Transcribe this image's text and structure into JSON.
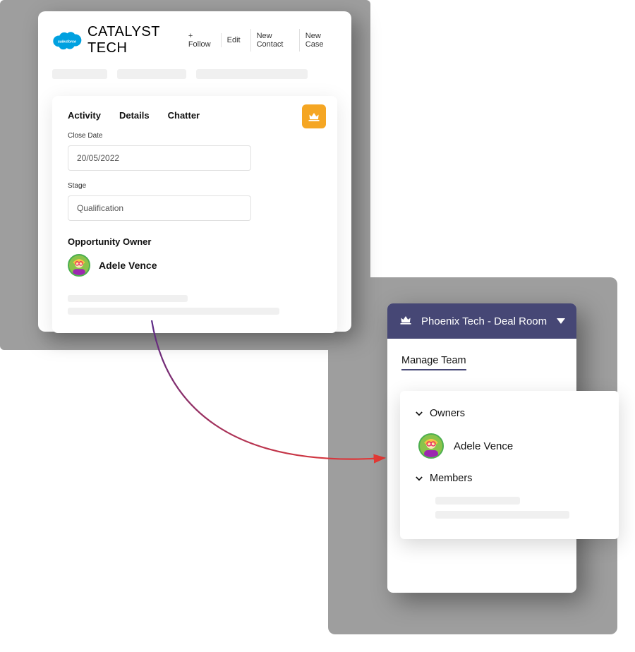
{
  "salesforce": {
    "logo_text": "salesforce",
    "account_name": "CATALYST TECH",
    "actions": {
      "follow": "+ Follow",
      "edit": "Edit",
      "new_contact": "New Contact",
      "new_case": "New Case"
    },
    "tabs": [
      "Activity",
      "Details",
      "Chatter"
    ],
    "fields": {
      "close_date_label": "Close Date",
      "close_date_value": "20/05/2022",
      "stage_label": "Stage",
      "stage_value": "Qualification"
    },
    "owner_label": "Opportunity Owner",
    "owner_name": "Adele Vence"
  },
  "teams": {
    "header_title": "Phoenix Tech - Deal Room",
    "tab_label": "Manage Team",
    "groups": {
      "owners_label": "Owners",
      "members_label": "Members"
    },
    "owner_name": "Adele Vence"
  },
  "colors": {
    "salesforce_blue": "#00A1E0",
    "crown_orange": "#F5A623",
    "teams_purple": "#464775",
    "avatar_green": "#8BC34A"
  }
}
